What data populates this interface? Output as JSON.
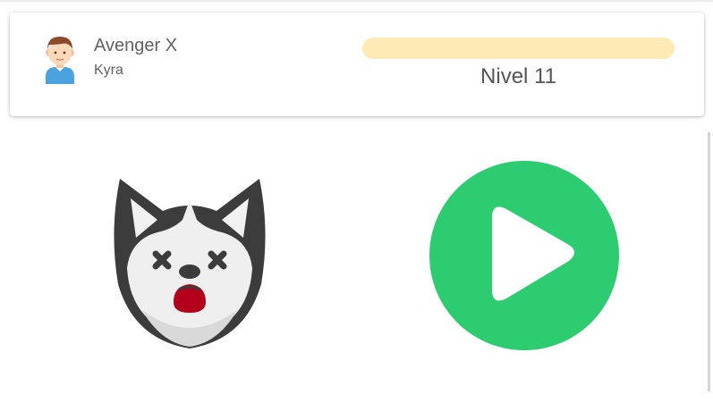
{
  "player": {
    "name": "Avenger X",
    "username": "Kyra",
    "avatar_icon": "boy-avatar-icon"
  },
  "level": {
    "label": "Nivel 11",
    "progress": 0,
    "bar_track_color": "#fdeab4",
    "bar_fill_color": "#f7c948"
  },
  "main": {
    "mascot_icon": "dead-husky-icon",
    "play_icon": "play-icon",
    "play_color": "#2ecc71"
  }
}
